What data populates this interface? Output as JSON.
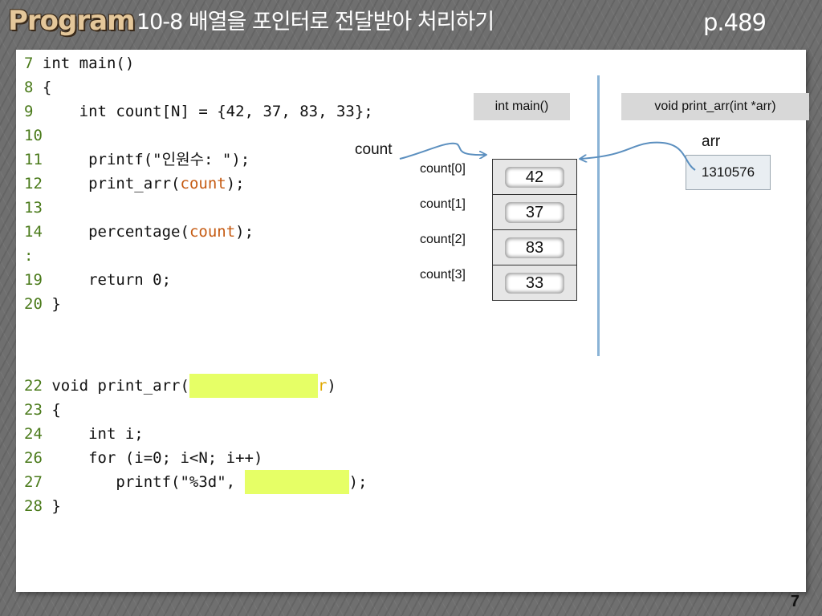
{
  "header": {
    "program_label": "Program",
    "title": "10-8 배열을 포인터로 전달받아 처리하기",
    "page": "p.489"
  },
  "code_main": [
    {
      "num": "7",
      "text": "int main()"
    },
    {
      "num": "8",
      "text": "{"
    },
    {
      "num": "9",
      "text": "    int count[N] = {42, 37, 83, 33};"
    },
    {
      "num": "10",
      "text": ""
    },
    {
      "num": "11",
      "text": "    printf(\"인원수: \");"
    },
    {
      "num": "12",
      "pre": "    print_arr(",
      "hl": "count",
      "post": ");"
    },
    {
      "num": "13",
      "text": ""
    },
    {
      "num": "14",
      "pre": "    percentage(",
      "hl": "count",
      "post": ");"
    },
    {
      "num": ":",
      "text": ""
    },
    {
      "num": "19",
      "text": "    return 0;"
    },
    {
      "num": "20",
      "text": "}"
    }
  ],
  "code_func": [
    {
      "num": "22",
      "pre": "void print_arr(",
      "post": ")",
      "tail_char": "r"
    },
    {
      "num": "23",
      "text": "{"
    },
    {
      "num": "24",
      "text": "    int i;"
    },
    {
      "num": "26",
      "text": "    for (i=0; i<N; i++)"
    },
    {
      "num": "27",
      "pre": "       printf(\"%3d\", ",
      "post": ");"
    },
    {
      "num": "28",
      "text": "}"
    }
  ],
  "diagram": {
    "main_label": "int main()",
    "func_label": "void print_arr(int *arr)",
    "count_label": "count",
    "arr_label": "arr",
    "arr_value": "1310576",
    "elements": [
      {
        "label": "count[0]",
        "value": "42"
      },
      {
        "label": "count[1]",
        "value": "37"
      },
      {
        "label": "count[2]",
        "value": "83"
      },
      {
        "label": "count[3]",
        "value": "33"
      }
    ]
  },
  "colors": {
    "highlight": "#e6ff66",
    "line_number": "#4a7a1a",
    "count_keyword": "#c55a11",
    "arrow": "#5b8fbf"
  },
  "slide_number": "7"
}
